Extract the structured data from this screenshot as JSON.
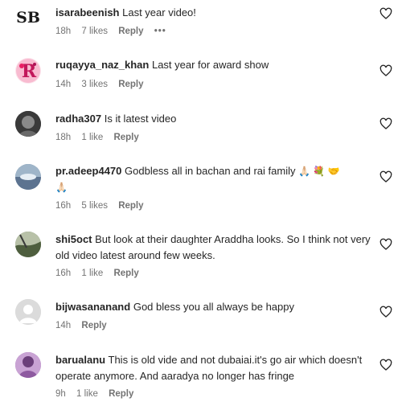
{
  "comments": [
    {
      "username": "isarabeenish",
      "text": "Last year video!",
      "time": "18h",
      "likes": "7 likes",
      "reply": "Reply",
      "more": "•••"
    },
    {
      "username": "ruqayya_naz_khan",
      "text": "Last year for award show",
      "time": "14h",
      "likes": "3 likes",
      "reply": "Reply"
    },
    {
      "username": "radha307",
      "text": "Is it latest video",
      "time": "18h",
      "likes": "1 like",
      "reply": "Reply"
    },
    {
      "username": "pr.adeep4470",
      "text": "Godbless all in bachan and rai family",
      "emojis": "🙏🏻 💐 🤝",
      "emojis2": "🙏🏻",
      "time": "16h",
      "likes": "5 likes",
      "reply": "Reply"
    },
    {
      "username": "shi5oct",
      "text": "But look at their daughter Araddha looks. So I think not very old video latest around few weeks.",
      "time": "16h",
      "likes": "1 like",
      "reply": "Reply"
    },
    {
      "username": "bijwasananand",
      "text": "God bless you all always be happy",
      "time": "14h",
      "reply": "Reply"
    },
    {
      "username": "barualanu",
      "text": "This is old vide and not dubaiai.it's go air which doesn't operate anymore. And aaradya no longer has fringe",
      "time": "9h",
      "likes": "1 like",
      "reply": "Reply"
    }
  ],
  "avatar_colors": [
    "#1a1a1a",
    "#c2185b",
    "#4a4a4a",
    "#6f8aa8",
    "#7a8b6e",
    "#d8d8d8",
    "#a070b0"
  ],
  "icons": {
    "like": "heart-outline-icon",
    "more": "ellipsis-icon"
  }
}
